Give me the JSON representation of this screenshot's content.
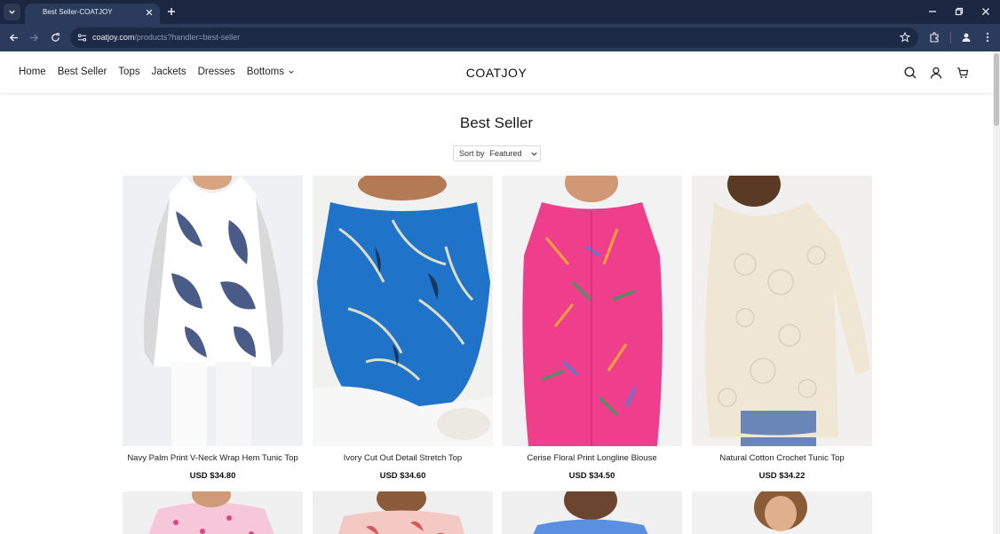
{
  "browser": {
    "tab_title": "Best Seller-COATJOY",
    "url_host": "coatjoy.com",
    "url_path": "/products?handler=best-seller",
    "icons": [
      "tab-list-icon",
      "close-icon",
      "plus-icon",
      "minimize-icon",
      "restore-icon",
      "close-window-icon",
      "back-icon",
      "forward-icon",
      "reload-icon",
      "site-info-icon",
      "star-icon",
      "extensions-icon",
      "profile-icon",
      "menu-dots-icon"
    ]
  },
  "header": {
    "nav": [
      "Home",
      "Best Seller",
      "Tops",
      "Jackets",
      "Dresses",
      "Bottoms"
    ],
    "logo": "COATJOY"
  },
  "page": {
    "title": "Best Seller",
    "sort_label": "Sort by",
    "sort_value": "Featured"
  },
  "products": [
    {
      "name": "Navy Palm Print V-Neck Wrap Hem Tunic Top",
      "price": "USD $34.80",
      "bg": "#eef0f3",
      "color": "#2b3f73"
    },
    {
      "name": "Ivory Cut Out Detail Stretch Top",
      "price": "USD $34.60",
      "bg": "#f1f1ef",
      "color": "#1f73c9"
    },
    {
      "name": "Cerise Floral Print Longline Blouse",
      "price": "USD $34.50",
      "bg": "#f2f2f2",
      "color": "#ef3f8c"
    },
    {
      "name": "Natural Cotton Crochet Tunic Top",
      "price": "USD $34.22",
      "bg": "#f1f0ee",
      "color": "#efe6d3"
    }
  ],
  "colors": {
    "tabbar": "#1b2740",
    "toolbar": "#2b3b5b",
    "omnibox": "#1d2a45"
  }
}
